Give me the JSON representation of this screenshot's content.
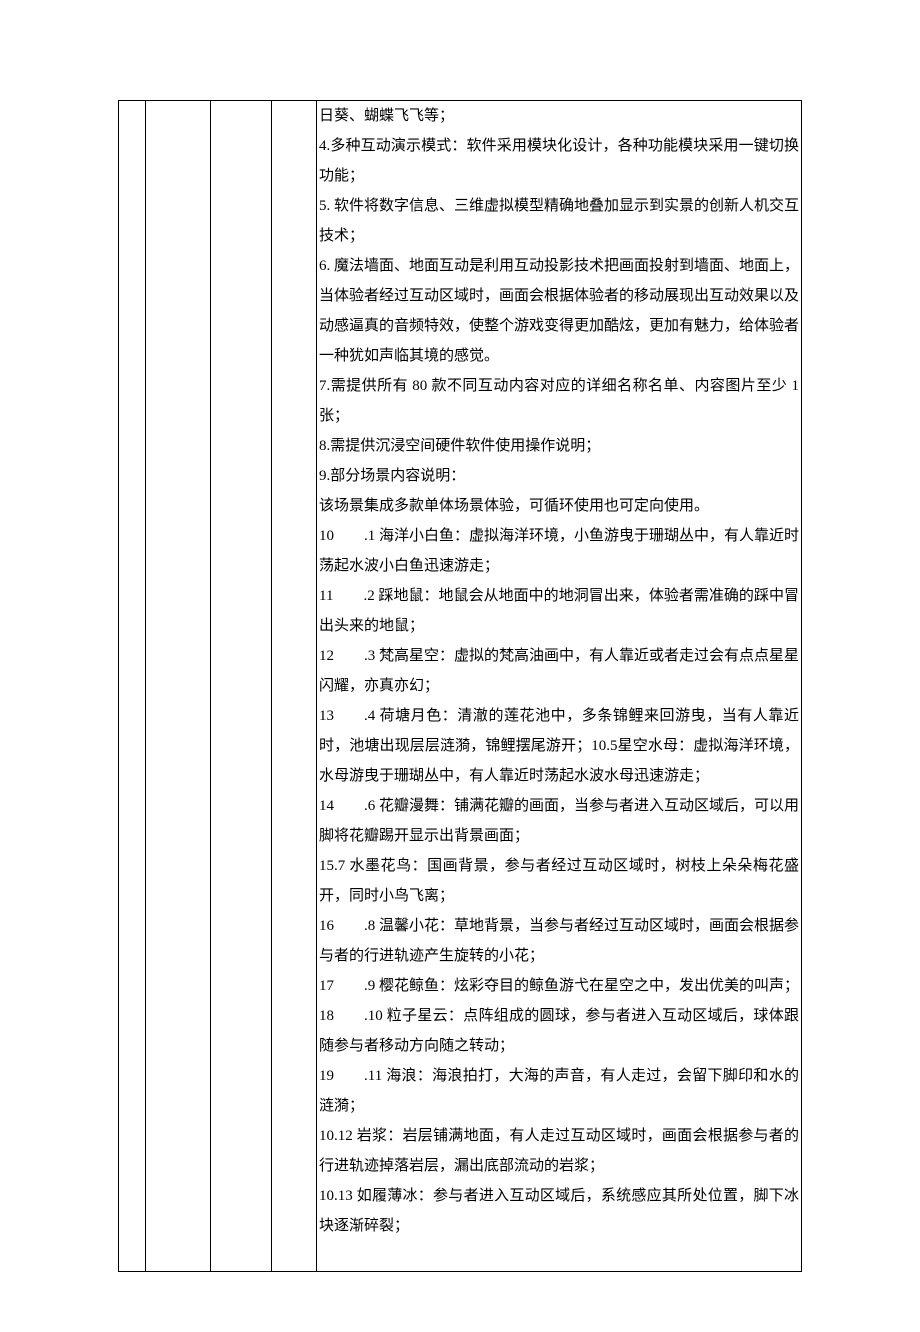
{
  "content": {
    "p0": "日葵、蝴蝶飞飞等；",
    "p1": "4.多种互动演示模式：软件采用模块化设计，各种功能模块采用一键切换功能；",
    "p2": "5. 软件将数字信息、三维虚拟模型精确地叠加显示到实景的创新人机交互技术；",
    "p3": "6. 魔法墙面、地面互动是利用互动投影技术把画面投射到墙面、地面上，当体验者经过互动区域时，画面会根据体验者的移动展现出互动效果以及动感逼真的音频特效，使整个游戏变得更加酷炫，更加有魅力，给体验者一种犹如声临其境的感觉。",
    "p4": "7.需提供所有 80 款不同互动内容对应的详细名称名单、内容图片至少 1 张；",
    "p5": "8.需提供沉浸空间硬件软件使用操作说明；",
    "p6": "9.部分场景内容说明：",
    "p7": "该场景集成多款单体场景体验，可循环使用也可定向使用。",
    "p8": "10  .1 海洋小白鱼：虚拟海洋环境，小鱼游曳于珊瑚丛中，有人靠近时荡起水波小白鱼迅速游走；",
    "p9": "11  .2 踩地鼠：地鼠会从地面中的地洞冒出来，体验者需准确的踩中冒出头来的地鼠；",
    "p10": "12  .3 梵高星空：虚拟的梵高油画中，有人靠近或者走过会有点点星星闪耀，亦真亦幻；",
    "p11": "13  .4 荷塘月色：清澈的莲花池中，多条锦鲤来回游曳，当有人靠近时，池塘出现层层涟漪，锦鲤摆尾游开；10.5星空水母：虚拟海洋环境，水母游曳于珊瑚丛中，有人靠近时荡起水波水母迅速游走；",
    "p12": "14  .6 花瓣漫舞：铺满花瓣的画面，当参与者进入互动区域后，可以用脚将花瓣踢开显示出背景画面；",
    "p13": "15.7 水墨花鸟：国画背景，参与者经过互动区域时，树枝上朵朵梅花盛开，同时小鸟飞离；",
    "p14": "16  .8 温馨小花：草地背景，当参与者经过互动区域时，画面会根据参与者的行进轨迹产生旋转的小花；",
    "p15": "17  .9 樱花鲸鱼：炫彩夺目的鲸鱼游弋在星空之中，发出优美的叫声；",
    "p16": "18  .10 粒子星云：点阵组成的圆球，参与者进入互动区域后，球体跟随参与者移动方向随之转动；",
    "p17": "19  .11 海浪：海浪拍打，大海的声音，有人走过，会留下脚印和水的涟漪；",
    "p18": "10.12 岩浆：岩层铺满地面，有人走过互动区域时，画面会根据参与者的行进轨迹掉落岩层，漏出底部流动的岩浆；",
    "p19": "10.13 如履薄冰：参与者进入互动区域后，系统感应其所处位置，脚下冰块逐渐碎裂；"
  }
}
